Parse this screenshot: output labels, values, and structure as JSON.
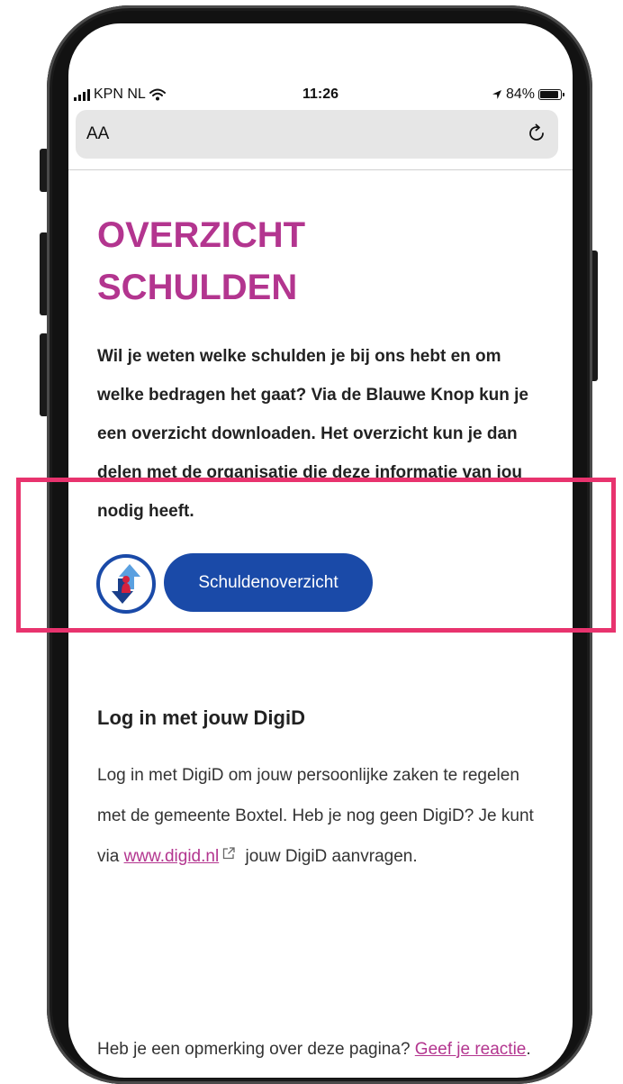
{
  "status_bar": {
    "carrier": "KPN NL",
    "time": "11:26",
    "battery": "84%"
  },
  "address_bar": {
    "text_size_button": "AA"
  },
  "page": {
    "title_line1": "OVERZICHT",
    "title_line2": "SCHULDEN",
    "intro": "Wil je weten welke schulden je bij ons hebt en om welke bedragen het gaat? Via de Blauwe Knop kun je een overzicht downloaden. Het overzicht kun je dan delen met de organisatie die deze informatie van jou nodig heeft.",
    "button_label": "Schuldenoverzicht",
    "digid": {
      "heading": "Log in met jouw DigiD",
      "text_before": "Log in met DigiD om jouw persoonlijke zaken te regelen met de gemeente Boxtel. Heb je nog geen DigiD? Je kunt via ",
      "link_text": "www.digid.nl",
      "text_after": " jouw DigiD aanvragen."
    },
    "feedback": {
      "text": "Heb je een opmerking over deze pagina? ",
      "link_text": "Geef je reactie",
      "text_end": "."
    }
  },
  "colors": {
    "title": "#b3358f",
    "button": "#1a4aa8",
    "highlight_border": "#e8336e",
    "link": "#b3358f"
  },
  "icons": [
    "signal-icon",
    "wifi-icon",
    "location-arrow-icon",
    "battery-icon",
    "reload-icon",
    "blauwe-knop-logo",
    "external-link-icon"
  ]
}
